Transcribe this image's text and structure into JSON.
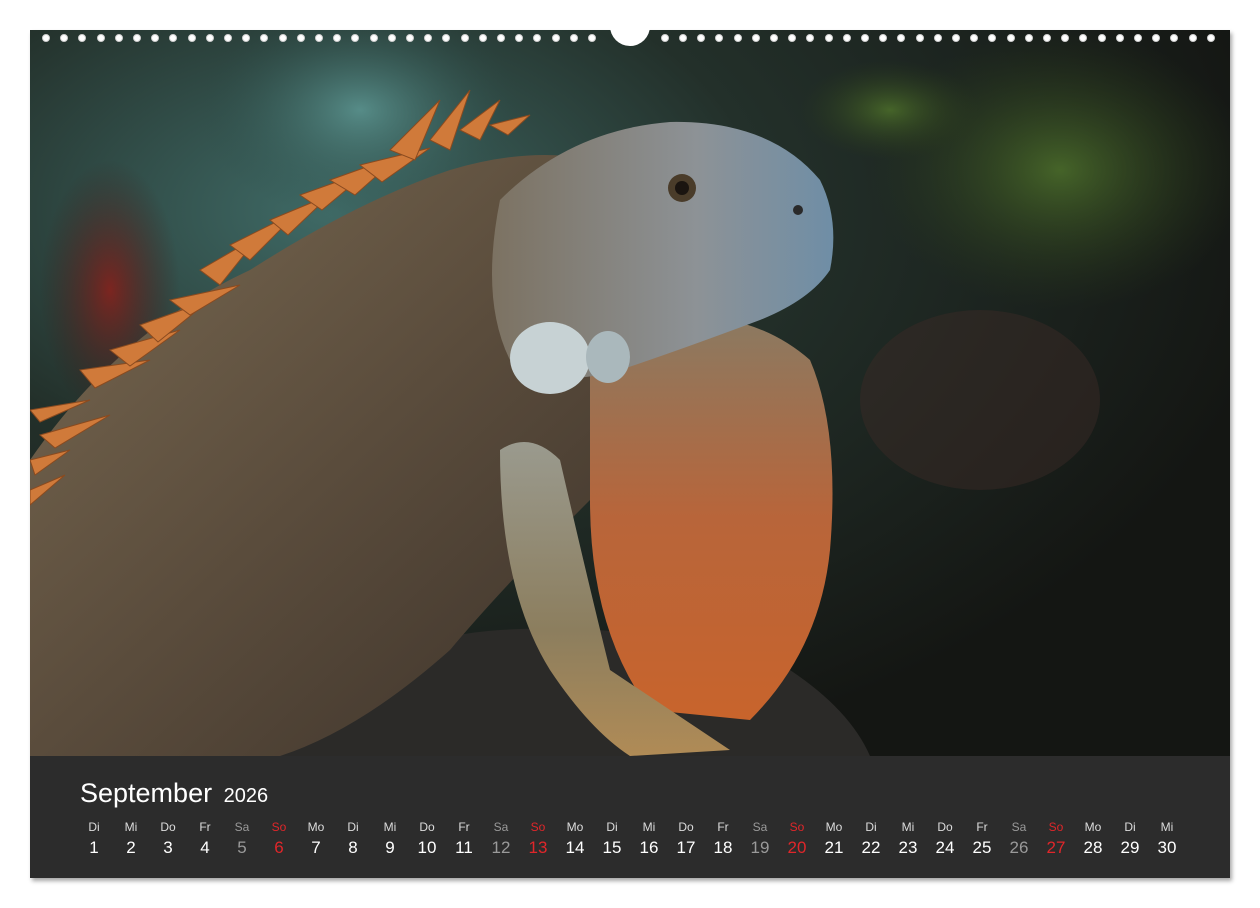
{
  "calendar": {
    "month": "September",
    "year": "2026",
    "days": [
      {
        "wd": "Di",
        "n": "1",
        "type": "weekday"
      },
      {
        "wd": "Mi",
        "n": "2",
        "type": "weekday"
      },
      {
        "wd": "Do",
        "n": "3",
        "type": "weekday"
      },
      {
        "wd": "Fr",
        "n": "4",
        "type": "weekday"
      },
      {
        "wd": "Sa",
        "n": "5",
        "type": "sat"
      },
      {
        "wd": "So",
        "n": "6",
        "type": "sun"
      },
      {
        "wd": "Mo",
        "n": "7",
        "type": "weekday"
      },
      {
        "wd": "Di",
        "n": "8",
        "type": "weekday"
      },
      {
        "wd": "Mi",
        "n": "9",
        "type": "weekday"
      },
      {
        "wd": "Do",
        "n": "10",
        "type": "weekday"
      },
      {
        "wd": "Fr",
        "n": "11",
        "type": "weekday"
      },
      {
        "wd": "Sa",
        "n": "12",
        "type": "sat"
      },
      {
        "wd": "So",
        "n": "13",
        "type": "sun"
      },
      {
        "wd": "Mo",
        "n": "14",
        "type": "weekday"
      },
      {
        "wd": "Di",
        "n": "15",
        "type": "weekday"
      },
      {
        "wd": "Mi",
        "n": "16",
        "type": "weekday"
      },
      {
        "wd": "Do",
        "n": "17",
        "type": "weekday"
      },
      {
        "wd": "Fr",
        "n": "18",
        "type": "weekday"
      },
      {
        "wd": "Sa",
        "n": "19",
        "type": "sat"
      },
      {
        "wd": "So",
        "n": "20",
        "type": "sun"
      },
      {
        "wd": "Mo",
        "n": "21",
        "type": "weekday"
      },
      {
        "wd": "Di",
        "n": "22",
        "type": "weekday"
      },
      {
        "wd": "Mi",
        "n": "23",
        "type": "weekday"
      },
      {
        "wd": "Do",
        "n": "24",
        "type": "weekday"
      },
      {
        "wd": "Fr",
        "n": "25",
        "type": "weekday"
      },
      {
        "wd": "Sa",
        "n": "26",
        "type": "sat"
      },
      {
        "wd": "So",
        "n": "27",
        "type": "sun"
      },
      {
        "wd": "Mo",
        "n": "28",
        "type": "weekday"
      },
      {
        "wd": "Di",
        "n": "29",
        "type": "weekday"
      },
      {
        "wd": "Mi",
        "n": "30",
        "type": "weekday"
      }
    ]
  },
  "colors": {
    "panel": "#2c2c2c",
    "sunday": "#e0262a",
    "saturday": "#9a9a9a",
    "iguana_body": "#6b5a45",
    "iguana_dewlap": "#c0652e",
    "iguana_spines": "#d07a3a",
    "iguana_head": "#8a8f92"
  }
}
